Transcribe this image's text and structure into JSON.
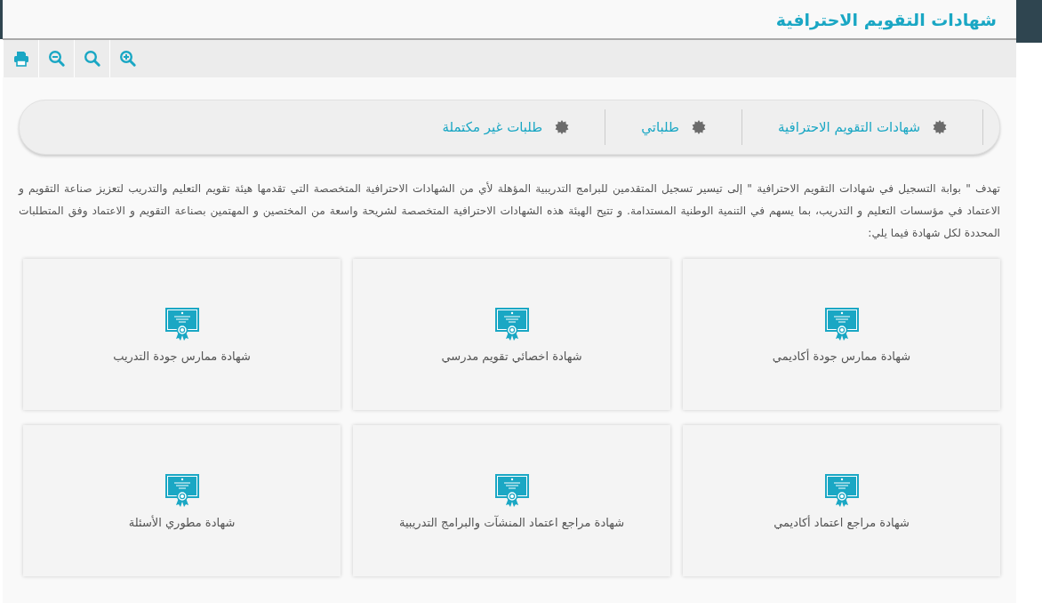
{
  "header": {
    "title": "شهادات التقويم الاحترافية"
  },
  "toolbar": [
    {
      "kind": "print"
    },
    {
      "kind": "zoom-out"
    },
    {
      "kind": "search"
    },
    {
      "kind": "zoom-in"
    }
  ],
  "tabs": [
    {
      "label": "شهادات التقويم الاحترافية"
    },
    {
      "label": "طلباتي"
    },
    {
      "label": "طلبات غير مكتملة"
    }
  ],
  "intro": "تهدف \" بوابة التسجيل في شهادات التقويم الاحترافية \" إلى تيسير تسجيل المتقدمين للبرامج التدريبية المؤهلة لأي من الشهادات الاحترافية المتخصصة التي تقدمها هيئة تقويم التعليم والتدريب لتعزيز صناعة التقويم و الاعتماد في مؤسسات التعليم و التدريب، بما يسهم في التنمية الوطنية المستدامة. و تتيح الهيئة هذه الشهادات الاحترافية المتخصصة لشريحة واسعة من المختصين و المهتمين بصناعة التقويم و الاعتماد وفق المتطلبات المحددة لكل شهادة فيما يلي:",
  "certificates": [
    {
      "label": "شهادة ممارس جودة أكاديمي"
    },
    {
      "label": "شهادة اخصائي تقويم مدرسي"
    },
    {
      "label": "شهادة ممارس جودة التدريب"
    },
    {
      "label": "شهادة مراجع اعتماد أكاديمي"
    },
    {
      "label": "شهادة مراجع اعتماد المنشآت والبرامج التدريبية"
    },
    {
      "label": "شهادة مطوري الأسئلة"
    }
  ]
}
